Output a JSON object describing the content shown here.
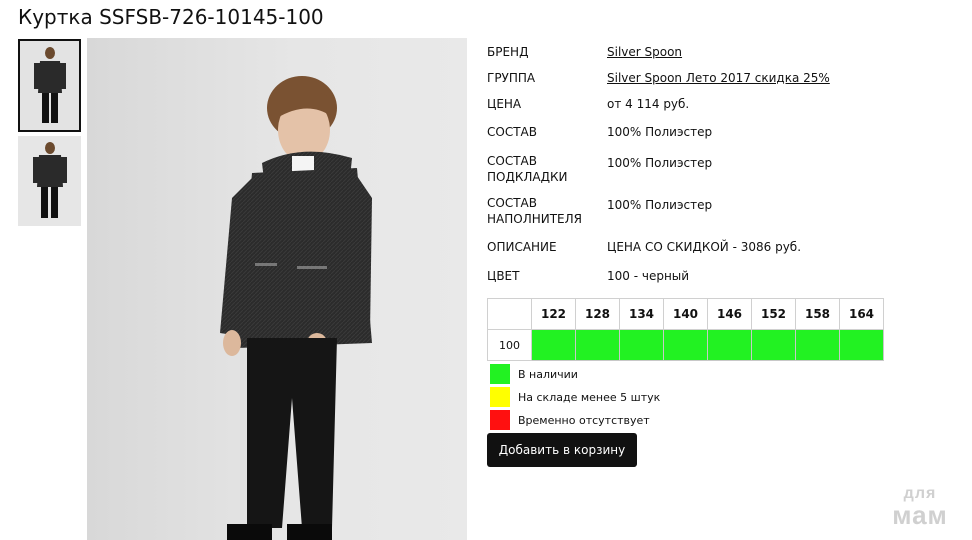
{
  "product": {
    "title": "Куртка SSFSB-726-10145-100"
  },
  "gallery": {
    "thumbnails": [
      "front-view",
      "back-view"
    ],
    "selected_index": 0
  },
  "properties": {
    "brand": {
      "label": "БРЕНД",
      "value": "Silver Spoon"
    },
    "group": {
      "label": "ГРУППА",
      "value": "Silver Spoon Лето 2017 скидка 25%"
    },
    "price": {
      "label": "ЦЕНА",
      "value": "от 4 114 руб."
    },
    "composition": {
      "label": "СОСТАВ",
      "value": "100% Полиэстер"
    },
    "lining": {
      "label_line1": "СОСТАВ",
      "label_line2": "ПОДКЛАДКИ",
      "value": "100% Полиэстер"
    },
    "filler": {
      "label_line1": "СОСТАВ",
      "label_line2": "НАПОЛНИТЕЛЯ",
      "value": "100% Полиэстер"
    },
    "description": {
      "label": "ОПИСАНИЕ",
      "value": "ЦЕНА СО СКИДКОЙ - 3086 руб."
    },
    "color": {
      "label": "ЦВЕТ",
      "value": "100 - черный"
    }
  },
  "sizes": {
    "headers": [
      "122",
      "128",
      "134",
      "140",
      "146",
      "152",
      "158",
      "164"
    ],
    "rows": [
      {
        "label": "100",
        "status": [
          "in_stock",
          "in_stock",
          "in_stock",
          "in_stock",
          "in_stock",
          "in_stock",
          "in_stock",
          "in_stock"
        ]
      }
    ]
  },
  "legend": {
    "in_stock": {
      "text": "В наличии",
      "color": "#22f222"
    },
    "low_stock": {
      "text": "На складе менее 5 штук",
      "color": "#ffff00"
    },
    "out_of_stock": {
      "text": "Временно отсутствует",
      "color": "#ff1010"
    }
  },
  "actions": {
    "add_to_cart": "Добавить в корзину"
  },
  "watermark": {
    "line1": "для",
    "line2": "мам"
  }
}
